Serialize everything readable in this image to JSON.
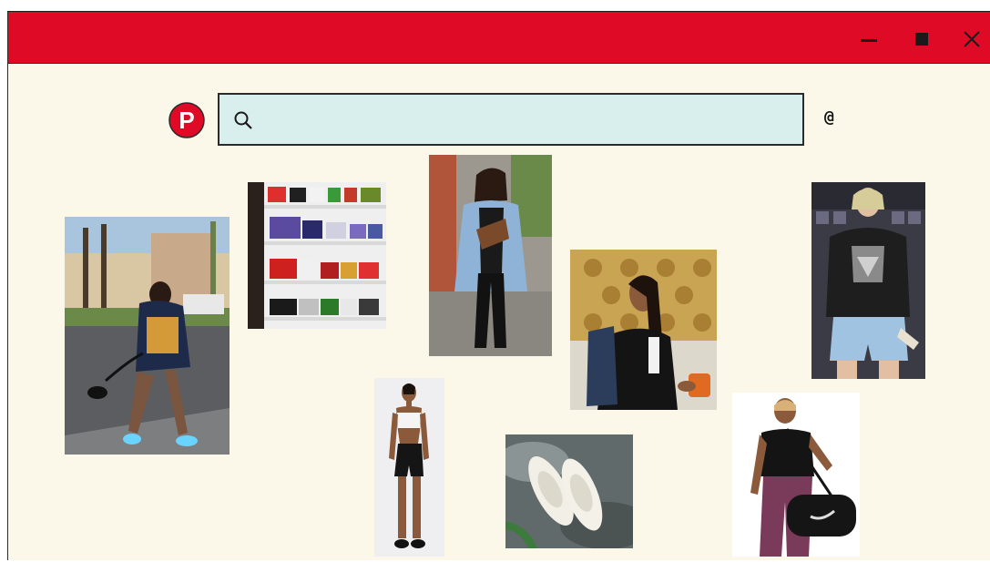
{
  "window": {
    "title": "",
    "accent_color": "#de0a26",
    "background_color": "#fbf8ea",
    "controls": [
      "minimize-icon",
      "maximize-icon",
      "close-icon"
    ]
  },
  "header": {
    "logo_letter": "P",
    "search": {
      "value": "",
      "placeholder": "",
      "icon": "search-icon"
    },
    "at_symbol": "@"
  },
  "pins": [
    {
      "id": "pin-street-style-woman-sling-bag",
      "icon": "photo"
    },
    {
      "id": "pin-sneaker-shelf",
      "icon": "photo"
    },
    {
      "id": "pin-denim-jacket-belt-bag",
      "icon": "photo"
    },
    {
      "id": "pin-woman-backpack-coffee",
      "icon": "photo"
    },
    {
      "id": "pin-graphic-tee-denim-shorts",
      "icon": "photo"
    },
    {
      "id": "pin-sports-bra-shorts",
      "icon": "photo"
    },
    {
      "id": "pin-white-slip-on-shoes",
      "icon": "photo"
    },
    {
      "id": "pin-duffel-bag-model",
      "icon": "photo"
    }
  ]
}
